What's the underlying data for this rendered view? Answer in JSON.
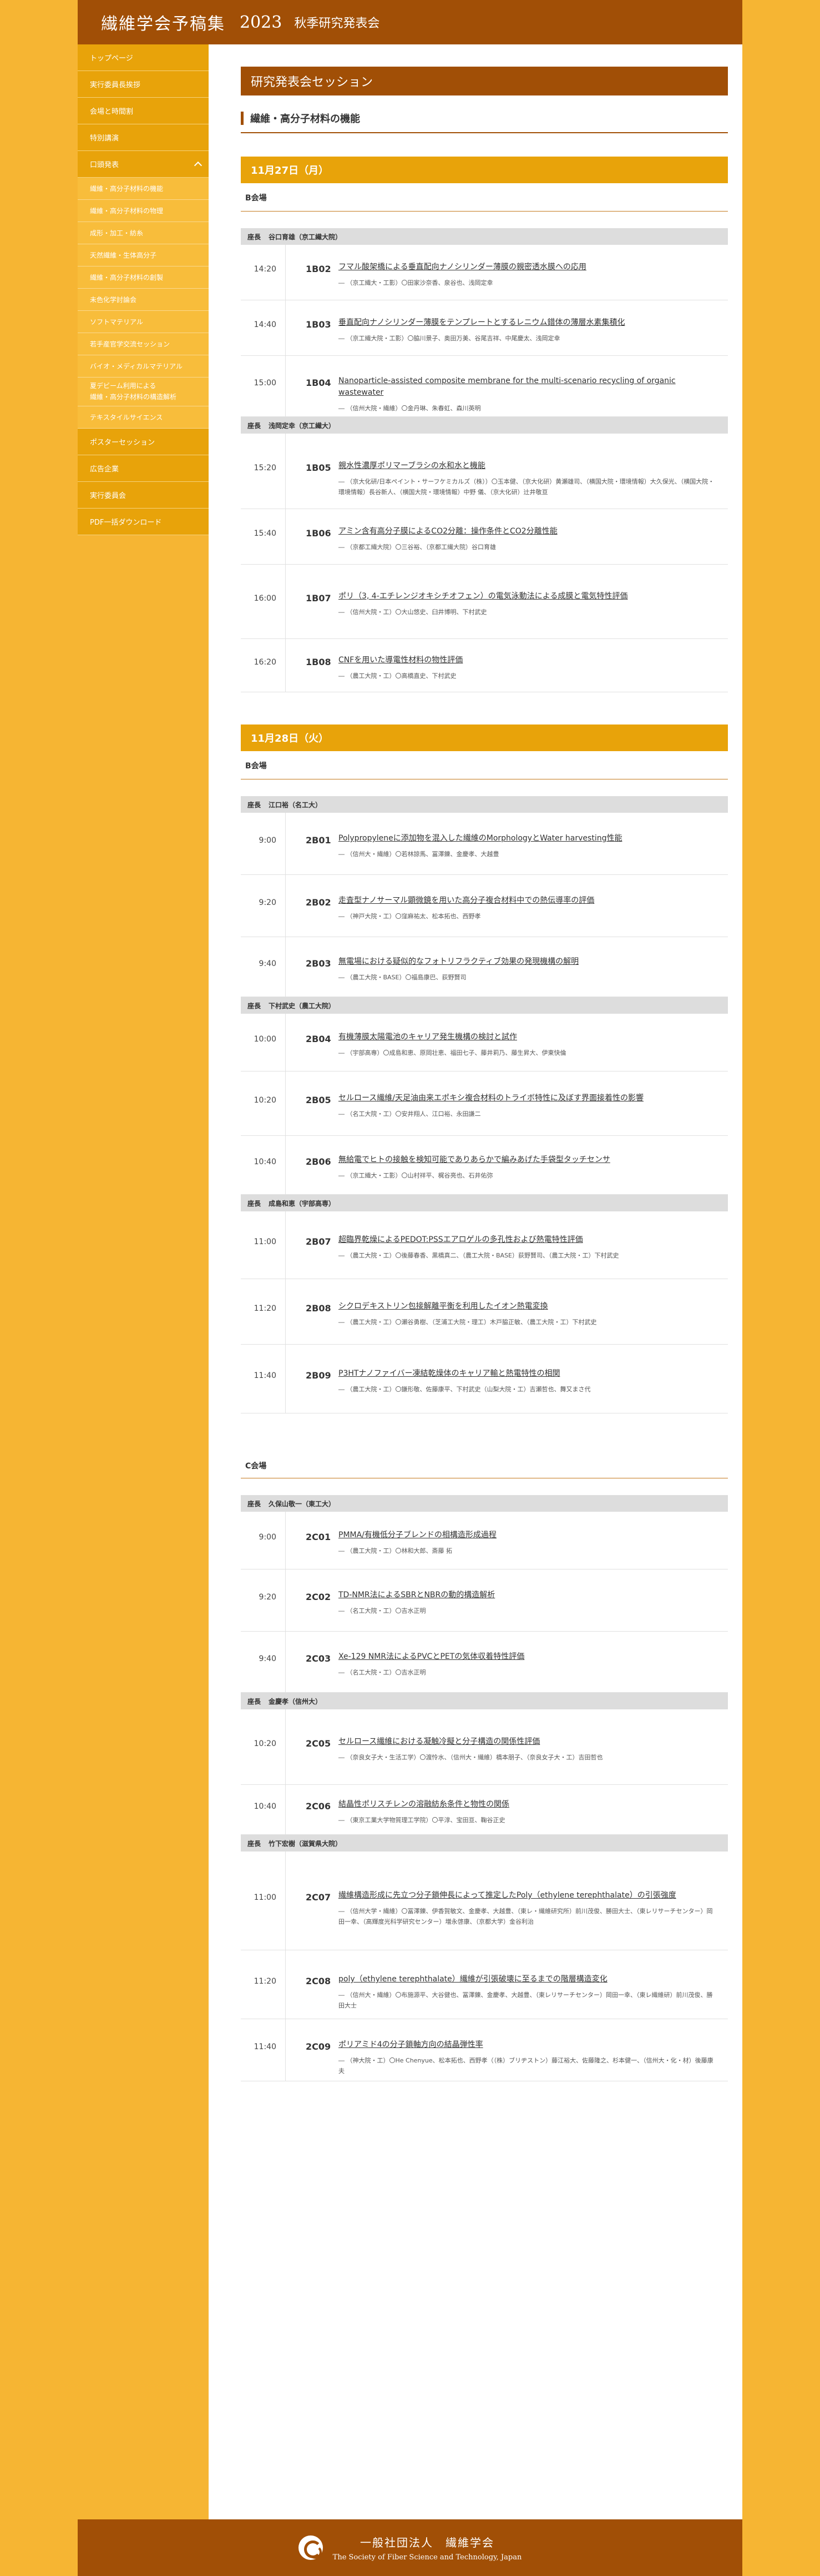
{
  "header": {
    "title": "繊維学会予稿集",
    "year": "2023",
    "subtitle": "秋季研究発表会"
  },
  "nav": [
    {
      "label": "トップページ",
      "sub": false
    },
    {
      "label": "実行委員長挨拶",
      "sub": false
    },
    {
      "label": "会場と時間割",
      "sub": false
    },
    {
      "label": "特別講演",
      "sub": false
    },
    {
      "label": "口頭発表",
      "sub": false,
      "open": true
    },
    {
      "label": "繊維・高分子材料の機能",
      "sub": true
    },
    {
      "label": "繊維・高分子材料の物理",
      "sub": true
    },
    {
      "label": "成形・加工・紡糸",
      "sub": true
    },
    {
      "label": "天然繊維・生体高分子",
      "sub": true
    },
    {
      "label": "繊維・高分子材料の創製",
      "sub": true
    },
    {
      "label": "未色化学討論会",
      "sub": true
    },
    {
      "label": "ソフトマテリアル",
      "sub": true
    },
    {
      "label": "若手産官学交流セッション",
      "sub": true
    },
    {
      "label": "バイオ・メディカルマテリアル",
      "sub": true
    },
    {
      "label": "夏デビーム利用による\n繊維・高分子材料の構造解析",
      "sub": true,
      "tall": true
    },
    {
      "label": "テキスタイルサイエンス",
      "sub": true
    },
    {
      "label": "ポスターセッション",
      "sub": false
    },
    {
      "label": "広告企業",
      "sub": false
    },
    {
      "label": "実行委員会",
      "sub": false
    },
    {
      "label": "PDF一括ダウンロード",
      "sub": false
    }
  ],
  "main": {
    "section_title": "研究発表会セッション",
    "category": "繊維・高分子材料の機能",
    "days": [
      {
        "date": "11月27日（月）",
        "rooms": [
          {
            "room": "B会場",
            "groups": [
              {
                "chair_label": "座長",
                "chair": "谷口育雄（京工繊大院）",
                "talks": [
                  {
                    "time": "14:20",
                    "id": "1B02",
                    "title": "フマル酸架橋による垂直配向ナノシリンダー薄膜の親密透水膜への応用",
                    "authors": "― （京工繊大・工影）〇田家沙奈香、泉谷也、浅岡定幸",
                    "h": 100
                  },
                  {
                    "time": "14:40",
                    "id": "1B03",
                    "title": "垂直配向ナノシリンダー薄膜をテンプレートとするレニウム錯体の薄層水素集積化",
                    "authors": "― （京工繊大院・工影）〇脇川景子、奥田万美、谷尾吉祥、中尾慶太、浅岡定幸",
                    "h": 100
                  },
                  {
                    "time": "15:00",
                    "id": "1B04",
                    "title": "Nanoparticle-assisted composite membrane for the multi-scenario recycling of organic wastewater",
                    "authors": "― （信州大院・繊維）〇金丹琳、朱春虹、森川英明",
                    "h": 110
                  }
                ]
              },
              {
                "chair_label": "座長",
                "chair": "浅岡定幸（京工繊大）",
                "talks": [
                  {
                    "time": "15:20",
                    "id": "1B05",
                    "title": "親水性濃厚ポリマーブラシの水和水と機能",
                    "authors": "― （京大化研/日本ペイント・サーフケミカルズ（株））〇玉本健、（京大化研）黄瀬雄司、（横国大院・環境情報）大久保光、（横国大院・環境情報）長谷新人、（横国大院・環境情報）中野 儀、（京大化研）辻井敬亘",
                    "h": 136
                  },
                  {
                    "time": "15:40",
                    "id": "1B06",
                    "title": "アミン含有高分子膜によるCO2分離：操作条件とCO2分離性能",
                    "authors": "― （京都工繊大院）〇三谷裕、（京都工繊大院）谷口育雄",
                    "h": 100
                  },
                  {
                    "time": "16:00",
                    "id": "1B07",
                    "title": "ポリ（3, 4-エチレンジオキシチオフェン）の電気泳動法による成膜と電気特性評価",
                    "authors": "― （信州大院・工）〇大山悠史、臼井博明、下村武史",
                    "h": 134
                  },
                  {
                    "time": "16:20",
                    "id": "1B08",
                    "title": "CNFを用いた導電性材料の物性評価",
                    "authors": "― （農工大院・工）〇高橋直史、下村武史",
                    "h": 96
                  }
                ]
              }
            ]
          }
        ]
      },
      {
        "date": "11月28日（火）",
        "rooms": [
          {
            "room": "B会場",
            "groups": [
              {
                "chair_label": "座長",
                "chair": "江口裕（名工大）",
                "talks": [
                  {
                    "time": "9:00",
                    "id": "2B01",
                    "title": "Polypropyleneに添加物を混入した繊維のMorphologyとWater harvesting性能",
                    "authors": "― （信州大・繊維）〇若林諒馬、冨澤錬、金慶孝、大越豊",
                    "h": 112
                  },
                  {
                    "time": "9:20",
                    "id": "2B02",
                    "title": "走査型ナノサーマル顕微鏡を用いた高分子複合材料中での熱伝導率の評価",
                    "authors": "― （神戸大院・工）〇窪麻祐太、松本拓也、西野孝",
                    "h": 112
                  },
                  {
                    "time": "9:40",
                    "id": "2B03",
                    "title": "無電場における疑似的なフォトリフラクティブ効果の発現機構の解明",
                    "authors": "― （農工大院・BASE）〇福島康巴、荻野賢司",
                    "h": 108
                  }
                ]
              },
              {
                "chair_label": "座長",
                "chair": "下村武史（農工大院）",
                "talks": [
                  {
                    "time": "10:00",
                    "id": "2B04",
                    "title": "有機薄膜太陽電池のキャリア発生機構の検討と試作",
                    "authors": "― （宇部高専）〇成島和恵、原岡壮恵、福田七子、藤井莉乃、藤生昇大、伊東快倫",
                    "h": 104
                  },
                  {
                    "time": "10:20",
                    "id": "2B05",
                    "title": "セルロース繊維/天足油由来エポキシ複合材料のトライボ特性に及ぼす界面接着性の影響",
                    "authors": "― （名工大院・工）〇安井翔人、江口裕、永田謙二",
                    "h": 116
                  },
                  {
                    "time": "10:40",
                    "id": "2B06",
                    "title": "無給電でヒトの接触を検知可能でありあらかで編みあげた手袋型タッチセンサ",
                    "authors": "― （京工繊大・工影）〇山村祥平、梶谷亮也、石井佑弥",
                    "h": 106
                  }
                ]
              },
              {
                "chair_label": "座長",
                "chair": "成島和恵（宇部高専）",
                "talks": [
                  {
                    "time": "11:00",
                    "id": "2B07",
                    "title": "超臨界乾燥によるPEDOT:PSSエアロゲルの多孔性および熱電特性評価",
                    "authors": "― （農工大院・工）〇後藤春香、黒橋真二、（農工大院・BASE）荻野賢司、（農工大院・工）下村武史",
                    "h": 122
                  },
                  {
                    "time": "11:20",
                    "id": "2B08",
                    "title": "シクロデキストリン包接解離平衡を利用したイオン熱電変換",
                    "authors": "― （農工大院・工）〇瀬谷勇樹、（芝浦工大院・理工）木戸脇正敏、（農工大院・工）下村武史",
                    "h": 118
                  },
                  {
                    "time": "11:40",
                    "id": "2B09",
                    "title": "P3HTナノファイバー凍結乾燥体のキャリア輸と熱電特性の相関",
                    "authors": "― （農工大院・工）〇鎌形敬、佐藤康平、下村武史（山梨大院・工）吉瀬哲也、舞又まさ代",
                    "h": 124
                  }
                ]
              }
            ]
          },
          {
            "room": "C会場",
            "groups": [
              {
                "chair_label": "座長",
                "chair": "久保山敬一（東工大）",
                "talks": [
                  {
                    "time": "9:00",
                    "id": "2C01",
                    "title": "PMMA/有機低分子ブレンドの相構造形成過程",
                    "authors": "― （農工大院・工）〇林和大郎、斎藤 拓",
                    "h": 104
                  },
                  {
                    "time": "9:20",
                    "id": "2C02",
                    "title": "TD-NMR法によるSBRとNBRの動的構造解析",
                    "authors": "― （名工大院・工）〇吉水正明",
                    "h": 112
                  },
                  {
                    "time": "9:40",
                    "id": "2C03",
                    "title": "Xe-129 NMR法によるPVCとPETの気体収着特性評価",
                    "authors": "― （名工大院・工）〇吉水正明",
                    "h": 110
                  }
                ]
              },
              {
                "chair_label": "座長",
                "chair": "金慶孝（信州大）",
                "talks": [
                  {
                    "time": "10:20",
                    "id": "2C05",
                    "title": "セルロース繊維における凝触冷擬と分子構造の関係性評価",
                    "authors": "― （奈良女子大・生活工学）〇渡怜水、（信州大・繊維）橋本朋子、（奈良女子大・工）吉田哲也",
                    "h": 136
                  },
                  {
                    "time": "10:40",
                    "id": "2C06",
                    "title": "結晶性ポリスチレンの溶融紡糸条件と物性の関係",
                    "authors": "― （東京工業大学物質理工学院）〇平淳、宝田亘、鞠谷正史",
                    "h": 90
                  }
                ]
              },
              {
                "chair_label": "座長",
                "chair": "竹下宏樹（滋賀県大院）",
                "talks": [
                  {
                    "time": "11:00",
                    "id": "2C07",
                    "title": "繊維構造形成に先立つ分子鎖伸長によって推定したPoly（ethylene terephthalate）の引張強度",
                    "authors": "― （信州大学・繊維）〇冨澤錬、伊香賀敏文、金慶孝、大越豊、（東レ・繊維研究所）前川茂俊、勝田大士、（東レリサーチセンター）岡田一幸、（高輝度光科学研究センター）増永啓康、（京都大学）金谷利治",
                    "h": 178
                  },
                  {
                    "time": "11:20",
                    "id": "2C08",
                    "title": "poly（ethylene terephthalate）繊維が引張破壊に至るまでの階層構造変化",
                    "authors": "― （信州大・繊維）〇布施源平、大谷健也、冨澤錬、金慶孝、大越豊、（東レリサーチセンター）岡田一幸、（東レ繊維研）前川茂俊、勝田大士",
                    "h": 124
                  },
                  {
                    "time": "11:40",
                    "id": "2C09",
                    "title": "ポリアミド4の分子鎖軸方向の結晶弾性率",
                    "authors": "― （神大院・工）〇He Chenyue、松本拓也、西野孝（（株）ブリヂストン）藤江裕大、佐藤隆之、杉本健一、（信州大・化・材）後藤康夫",
                    "h": 112
                  }
                ]
              }
            ]
          }
        ]
      }
    ]
  },
  "footer": {
    "org": "一般社団法人　繊維学会",
    "org_en": "The Society of Fiber Science and Technology, Japan",
    "logo_icon": "society-logo-icon"
  }
}
